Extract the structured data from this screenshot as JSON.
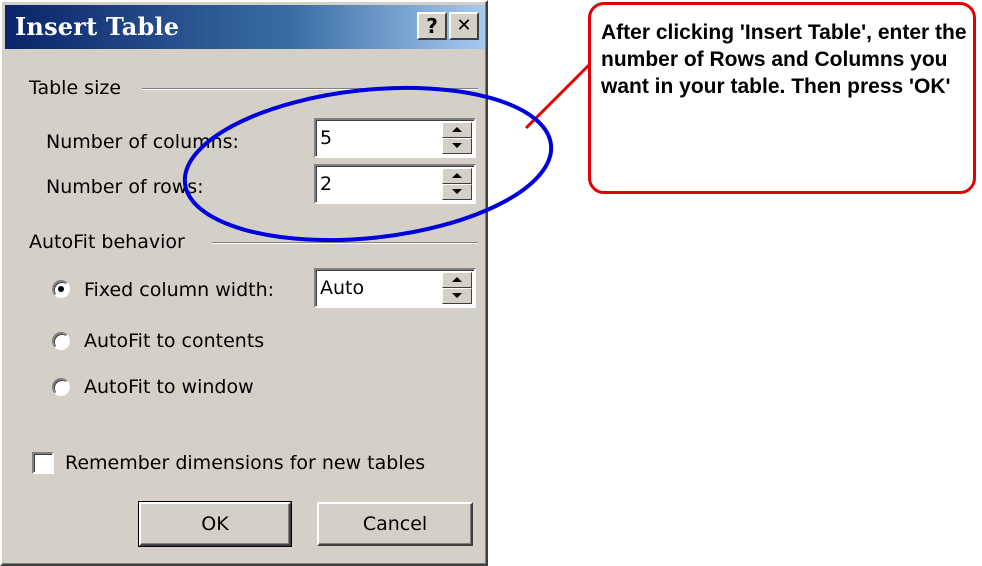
{
  "dialog": {
    "title": "Insert Table",
    "help_button": "?",
    "close_button": "✕",
    "table_size": {
      "group_label": "Table size",
      "columns_label": "Number of columns:",
      "columns_value": "5",
      "rows_label": "Number of rows:",
      "rows_value": "2"
    },
    "autofit": {
      "group_label": "AutoFit behavior",
      "fixed_label": "Fixed column width:",
      "fixed_value": "Auto",
      "contents_label": "AutoFit to contents",
      "window_label": "AutoFit to window",
      "selected": "fixed"
    },
    "remember_label": "Remember dimensions for new tables",
    "remember_checked": false,
    "ok_label": "OK",
    "cancel_label": "Cancel"
  },
  "annotation": {
    "callout_text": "After clicking 'Insert Table', enter the number of Rows and Columns you want in your table. Then press 'OK'",
    "callout_border_color": "#e00000",
    "ellipse_color": "#0000dd"
  }
}
